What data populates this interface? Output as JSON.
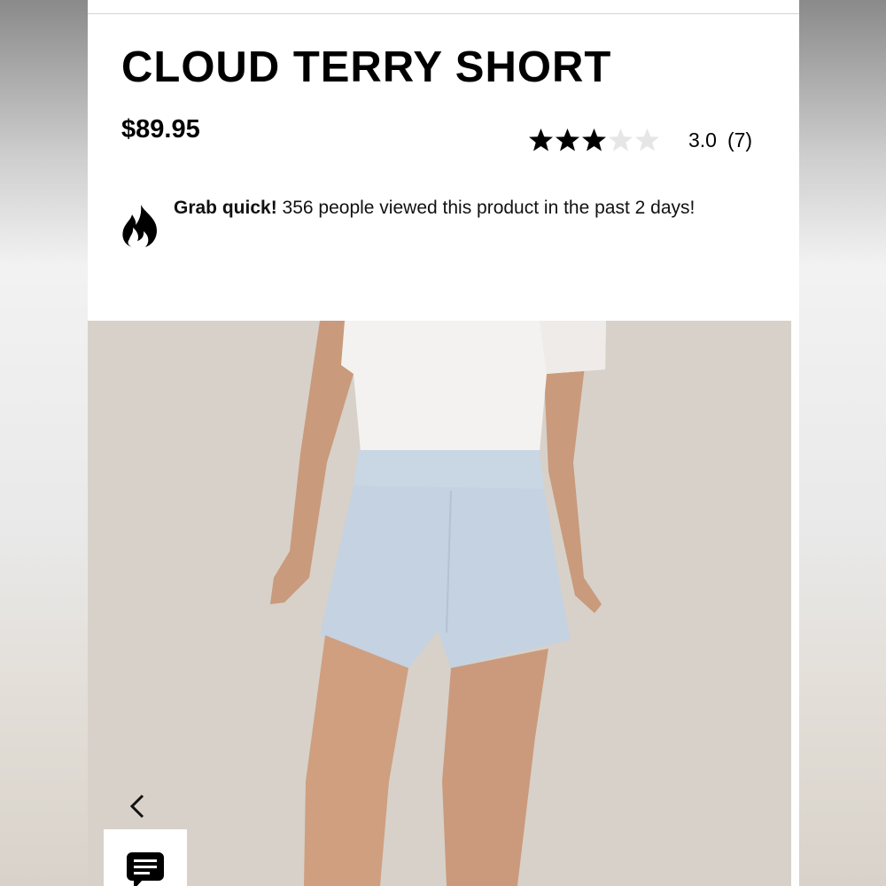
{
  "product": {
    "title": "CLOUD TERRY SHORT",
    "price": "$89.95"
  },
  "rating": {
    "value": 3.0,
    "max": 5,
    "value_label": "3.0",
    "count_label": "(7)",
    "filled_color": "#000000",
    "empty_color": "#e6e6e6"
  },
  "urgency": {
    "icon": "fire-icon",
    "bold_text": "Grab quick!",
    "text": " 356 people viewed this product in the past 2 days!"
  },
  "gallery": {
    "prev_icon": "chevron-left-icon",
    "chat_icon": "chat-bubble-icon"
  }
}
